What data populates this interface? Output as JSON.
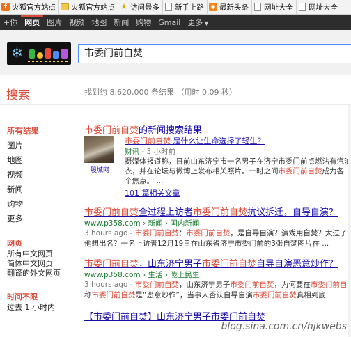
{
  "bookmarks": [
    {
      "label": "火狐官方站点",
      "icon": "firefox-icon"
    },
    {
      "label": "火狐官方站点",
      "icon": "folder-icon"
    },
    {
      "label": "访问最多",
      "icon": "star-icon"
    },
    {
      "label": "新手上路",
      "icon": "page-icon"
    },
    {
      "label": "最新头条",
      "icon": "rss-icon"
    },
    {
      "label": "网址大全",
      "icon": "page-icon"
    },
    {
      "label": "网址大全",
      "icon": "page-icon"
    }
  ],
  "gbar": {
    "plus": "+你",
    "items": [
      "网页",
      "图片",
      "视频",
      "地图",
      "新闻",
      "购物",
      "Gmail"
    ],
    "more": "更多"
  },
  "search": {
    "query": "市委门前自焚"
  },
  "left_title": "搜索",
  "stats": "找到约 8,620,000 条结果 （用时 0.09 秒）",
  "leftnav": {
    "items": [
      "所有结果",
      "图片",
      "地图",
      "视频",
      "新闻",
      "购物",
      "更多"
    ],
    "section1": {
      "title": "网页",
      "items": [
        "所有中文网页",
        "简体中文网页",
        "翻译的外文网页"
      ]
    },
    "section2": {
      "title": "时间不限",
      "items": [
        "过去 1 小时内"
      ]
    }
  },
  "news_block": {
    "title_hl": "市委门前自焚",
    "title_rest": "的新闻搜索结果",
    "thumb_source": "股城网",
    "sub_hl": "市委门前自焚",
    "sub_rest": " 是什么让生命选择了轻生？",
    "source": "财讯",
    "time": " - 3 小时前",
    "snippet1": "摄媒体报道称，日前山东济宁市一名男子在济宁市委门前点燃沾有汽油的",
    "snippet2a": "衣，并在论坛与微博上发布相关照片。一时之间",
    "snippet2b": "市委门前自焚",
    "snippet2c": "成为各",
    "snippet3": "个焦点。 ...",
    "related": "101 篇相关文章"
  },
  "results": [
    {
      "title_a": "市委门前自焚",
      "title_b": "全过程上访者",
      "title_c": "市委门前自焚",
      "title_d": "抗议拆迁，自导自演？",
      "url": "www.p358.com",
      "crumb": " › 新闻 › 国内新闻",
      "time": "3 hours ago - ",
      "s1a": "市委门前自焚",
      "s1b": "：",
      "s1c": "市委门前自焚",
      "s1d": "，是自导自演？演戏用自焚？太过了",
      "s2": "他想出名？一名上访者12月19日在山东省济宁市委门前的3张自焚图片在 ..."
    },
    {
      "title_a": "市委门前自焚",
      "title_b": "，山东济宁男子",
      "title_c": "市委门前自焚",
      "title_d": "自导自演恶意炒作？",
      "url": "www.p358.com",
      "crumb": " › 生活 › 陇上民生",
      "time": "3 hours ago - ",
      "s1a": "市委门前自焚",
      "s1b": "，山东济宁男子",
      "s1c": "市委门前自焚",
      "s1d": "，为何要在",
      "s1e": "市委门前自焚",
      "s2a": "称",
      "s2b": "市委门前自焚",
      "s2c": "是“恶意炒作”，当事人否认自导自演",
      "s2d": "市委门前自焚",
      "s2e": "真相到底"
    },
    {
      "title": "【市委门前自焚】山东济宁男子市委门前自焚"
    }
  ],
  "watermark": "blog.sina.com.cn/hjkwebs"
}
